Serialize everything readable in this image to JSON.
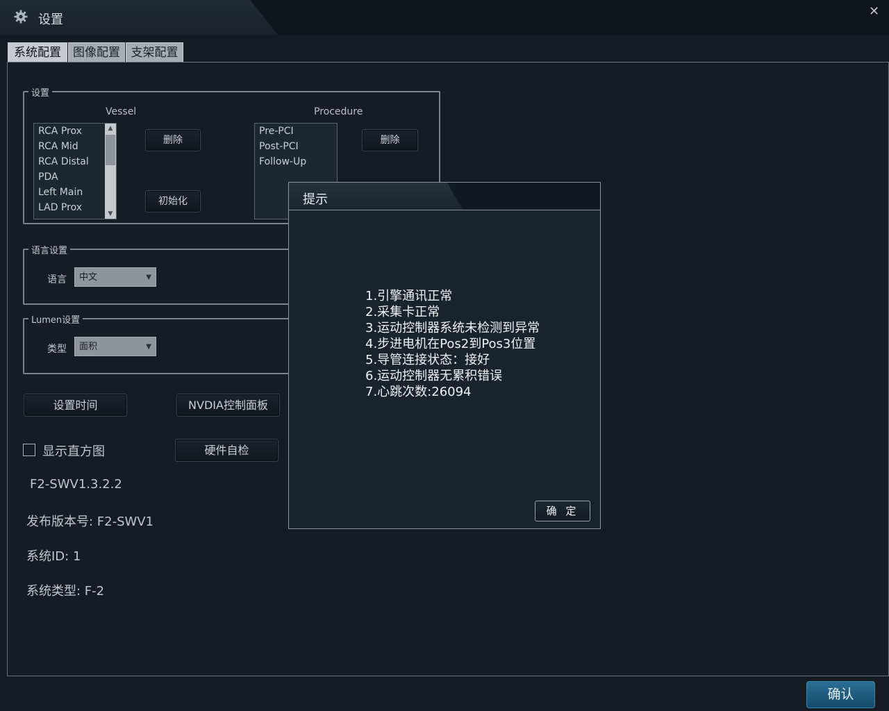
{
  "window": {
    "title": "设置",
    "close_symbol": "✕"
  },
  "tabs": [
    "系统配置",
    "图像配置",
    "支架配置"
  ],
  "settings_group": {
    "title": "设置",
    "vessel_header": "Vessel",
    "vessel_items": [
      "RCA Prox",
      "RCA Mid",
      "RCA Distal",
      "PDA",
      "Left Main",
      "LAD Prox"
    ],
    "vessel_delete": "删除",
    "vessel_init": "初始化",
    "procedure_header": "Procedure",
    "procedure_items": [
      "Pre-PCI",
      "Post-PCI",
      "Follow-Up"
    ],
    "procedure_delete": "删除"
  },
  "language_group": {
    "title": "语言设置",
    "label": "语言",
    "value": "中文"
  },
  "lumen_group": {
    "title": "Lumen设置",
    "label": "类型",
    "value": "面积"
  },
  "buttons": {
    "set_time": "设置时间",
    "nvidia": "NVDIA控制面板",
    "self_check": "硬件自检"
  },
  "show_histogram": {
    "label": "显示直方图",
    "checked": false
  },
  "version_info": {
    "sw_version": "F2-SWV1.3.2.2",
    "release": "发布版本号: F2-SWV1",
    "system_id": "系统ID: 1",
    "system_type": "系统类型: F-2"
  },
  "dialog": {
    "title": "提示",
    "messages": [
      "1.引擎通讯正常",
      "2.采集卡正常",
      "3.运动控制器系统未检测到异常",
      "4.步进电机在Pos2到Pos3位置",
      "5.导管连接状态：接好",
      "6.运动控制器无累积错误",
      "7.心跳次数:26094"
    ],
    "ok_label": "确 定"
  },
  "confirm_label": "确认",
  "colors": {
    "accent": "#1f5c80",
    "background": "#141b22",
    "dialog_bg": "#1a232c"
  }
}
